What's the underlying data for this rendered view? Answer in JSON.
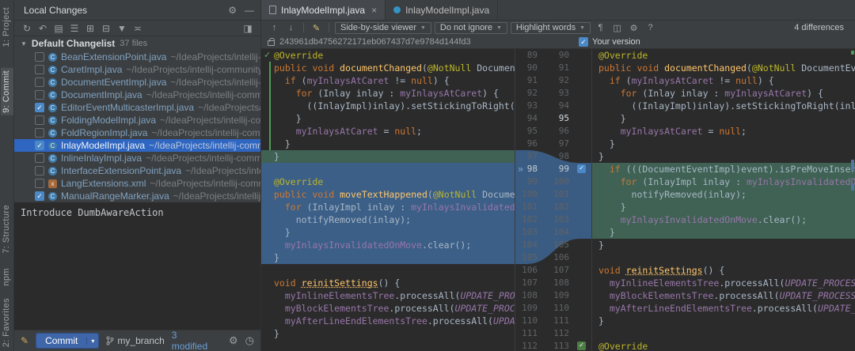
{
  "colors": {
    "accent": "#3592c4",
    "selection": "#2f66c1",
    "diff_changed": "#3c5f87",
    "diff_inserted": "#3f6254",
    "included_green": "#4e9c55"
  },
  "activity_bar": {
    "items": [
      {
        "id": "project",
        "label": "1: Project",
        "active": false
      },
      {
        "id": "commit",
        "label": "9: Commit",
        "active": true
      },
      {
        "id": "structure",
        "label": "7: Structure",
        "active": false
      },
      {
        "id": "npm",
        "label": "npm",
        "active": false
      },
      {
        "id": "favorites",
        "label": "2: Favorites",
        "active": false
      }
    ]
  },
  "changes_panel": {
    "title": "Local Changes",
    "header_icons": [
      {
        "id": "view-options",
        "glyph": "⚙"
      },
      {
        "id": "hide-panel",
        "glyph": "—"
      }
    ],
    "toolbar_icons": [
      {
        "id": "refresh",
        "glyph": "↻"
      },
      {
        "id": "rollback",
        "glyph": "↶"
      },
      {
        "id": "changelist",
        "glyph": "▤"
      },
      {
        "id": "group-by",
        "glyph": "☰"
      },
      {
        "id": "expand-all",
        "glyph": "⊞"
      },
      {
        "id": "collapse-all",
        "glyph": "⊟"
      },
      {
        "id": "filter",
        "glyph": "▼"
      },
      {
        "id": "compare",
        "glyph": "≍"
      }
    ],
    "toolbar_right_icon": {
      "id": "preview-diff",
      "glyph": "◨"
    },
    "changelist": {
      "expander": "▼",
      "name": "Default Changelist",
      "count": "37 files"
    },
    "files": [
      {
        "name": "BeanExtensionPoint.java",
        "path": "~/IdeaProjects/intellij-community",
        "checked": false,
        "selected": false,
        "type": "java"
      },
      {
        "name": "CaretImpl.java",
        "path": "~/IdeaProjects/intellij-community/p",
        "checked": false,
        "selected": false,
        "type": "java"
      },
      {
        "name": "DocumentEventImpl.java",
        "path": "~/IdeaProjects/intellij-community",
        "checked": false,
        "selected": false,
        "type": "java"
      },
      {
        "name": "DocumentImpl.java",
        "path": "~/IdeaProjects/intellij-community",
        "checked": false,
        "selected": false,
        "type": "java"
      },
      {
        "name": "EditorEventMulticasterImpl.java",
        "path": "~/IdeaProjects/intellij-community",
        "checked": true,
        "selected": false,
        "type": "java"
      },
      {
        "name": "FoldingModelImpl.java",
        "path": "~/IdeaProjects/intellij-community",
        "checked": false,
        "selected": false,
        "type": "java"
      },
      {
        "name": "FoldRegionImpl.java",
        "path": "~/IdeaProjects/intellij-community",
        "checked": false,
        "selected": false,
        "type": "java"
      },
      {
        "name": "InlayModelImpl.java",
        "path": "~/IdeaProjects/intellij-community",
        "checked": true,
        "selected": true,
        "type": "java"
      },
      {
        "name": "InlineInlayImpl.java",
        "path": "~/IdeaProjects/intellij-community",
        "checked": false,
        "selected": false,
        "type": "java"
      },
      {
        "name": "InterfaceExtensionPoint.java",
        "path": "~/IdeaProjects/intellij-community",
        "checked": false,
        "selected": false,
        "type": "java"
      },
      {
        "name": "LangExtensions.xml",
        "path": "~/IdeaProjects/intellij-community",
        "checked": false,
        "selected": false,
        "type": "xml"
      },
      {
        "name": "ManualRangeMarker.java",
        "path": "~/IdeaProjects/intellij-community",
        "checked": true,
        "selected": false,
        "type": "java"
      }
    ],
    "commit_message": "Introduce DumbAwareAction",
    "footer": {
      "commit_label": "Commit",
      "commit_arrow": "▾",
      "branch": "my_branch",
      "modified": "3 modified"
    }
  },
  "diff": {
    "tabs": [
      {
        "label": "InlayModelImpl.java",
        "close": "×"
      },
      {
        "label": "InlayModelImpl.java"
      }
    ],
    "toolbar": {
      "prev": "↑",
      "next": "↓",
      "edit": "✎",
      "viewer": "Side-by-side viewer",
      "ignore": "Do not ignore",
      "highlight": "Highlight words",
      "whitespace_glyph": "¶",
      "collapse_glyph": "◫",
      "settings_glyph": "⚙",
      "help": "?",
      "differences": "4 differences"
    },
    "left_title": "243961db4756272171eb067437d7e9784d144fd3",
    "right_title": "Your version",
    "current_change_row": 10,
    "bottom_check_row": 24,
    "apply_glyph": "»",
    "left_lines": [
      {
        "ln": 89,
        "seg": [
          [
            "a",
            "@Override"
          ]
        ]
      },
      {
        "ln": 90,
        "seg": [
          [
            "k",
            "public"
          ],
          [
            "t",
            " "
          ],
          [
            "k",
            "void"
          ],
          [
            "t",
            " "
          ],
          [
            "m",
            "documentChanged"
          ],
          [
            "t",
            "("
          ],
          [
            "a",
            "@NotNull"
          ],
          [
            "t",
            " DocumentEvent"
          ]
        ]
      },
      {
        "ln": 91,
        "seg": [
          [
            "t",
            "  "
          ],
          [
            "k",
            "if"
          ],
          [
            "t",
            " ("
          ],
          [
            "f",
            "myInlaysAtCaret"
          ],
          [
            "t",
            " != "
          ],
          [
            "k",
            "null"
          ],
          [
            "t",
            ") {"
          ]
        ]
      },
      {
        "ln": 92,
        "seg": [
          [
            "t",
            "    "
          ],
          [
            "k",
            "for"
          ],
          [
            "t",
            " (Inlay inlay : "
          ],
          [
            "f",
            "myInlaysAtCaret"
          ],
          [
            "t",
            ") {"
          ]
        ]
      },
      {
        "ln": 93,
        "seg": [
          [
            "t",
            "      ((InlayImpl)inlay).setStickingToRight(int"
          ]
        ]
      },
      {
        "ln": 94,
        "seg": [
          [
            "t",
            "    }"
          ]
        ]
      },
      {
        "ln": 95,
        "seg": [
          [
            "t",
            "    "
          ],
          [
            "f",
            "myInlaysAtCaret"
          ],
          [
            "t",
            " = "
          ],
          [
            "k",
            "null"
          ],
          [
            "t",
            ";"
          ]
        ]
      },
      {
        "ln": 96,
        "seg": [
          [
            "t",
            "  }"
          ]
        ]
      },
      {
        "ln": 97,
        "bg": "g",
        "seg": [
          [
            "t",
            "}"
          ]
        ]
      },
      {
        "ln": 98,
        "bg": "b",
        "seg": []
      },
      {
        "ln": 99,
        "bg": "b",
        "seg": [
          [
            "a",
            "@Override"
          ]
        ]
      },
      {
        "ln": 100,
        "bg": "b",
        "seg": [
          [
            "k",
            "public"
          ],
          [
            "t",
            " "
          ],
          [
            "k",
            "void"
          ],
          [
            "t",
            " "
          ],
          [
            "m",
            "moveTextHappened"
          ],
          [
            "t",
            "("
          ],
          [
            "a",
            "@NotNull"
          ],
          [
            "t",
            " DocumentEvent"
          ]
        ]
      },
      {
        "ln": 101,
        "bg": "b",
        "seg": [
          [
            "t",
            "  "
          ],
          [
            "k",
            "for"
          ],
          [
            "t",
            " (InlayImpl inlay : "
          ],
          [
            "f",
            "myInlaysInvalidatedOnMove"
          ],
          [
            "t",
            ") {"
          ]
        ]
      },
      {
        "ln": 102,
        "bg": "b",
        "seg": [
          [
            "t",
            "    notifyRemoved(inlay);"
          ]
        ]
      },
      {
        "ln": 103,
        "bg": "b",
        "seg": [
          [
            "t",
            "  }"
          ]
        ]
      },
      {
        "ln": 104,
        "bg": "b",
        "seg": [
          [
            "t",
            "  "
          ],
          [
            "f",
            "myInlaysInvalidatedOnMove"
          ],
          [
            "t",
            ".clear();"
          ]
        ]
      },
      {
        "ln": 105,
        "bg": "b",
        "seg": [
          [
            "t",
            "}"
          ]
        ]
      },
      {
        "ln": 106,
        "seg": []
      },
      {
        "ln": 107,
        "seg": [
          [
            "k",
            "void"
          ],
          [
            "t",
            " "
          ],
          [
            "mu",
            "reinitSettings"
          ],
          [
            "t",
            "() {"
          ]
        ]
      },
      {
        "ln": 108,
        "seg": [
          [
            "t",
            "  "
          ],
          [
            "f",
            "myInlineElementsTree"
          ],
          [
            "t",
            ".processAll("
          ],
          [
            "c",
            "UPDATE_PROCESSOR"
          ]
        ]
      },
      {
        "ln": 109,
        "seg": [
          [
            "t",
            "  "
          ],
          [
            "f",
            "myBlockElementsTree"
          ],
          [
            "t",
            ".processAll("
          ],
          [
            "c",
            "UPDATE_PROCESSOR"
          ]
        ]
      },
      {
        "ln": 110,
        "seg": [
          [
            "t",
            "  "
          ],
          [
            "f",
            "myAfterLineEndElementsTree"
          ],
          [
            "t",
            ".processAll("
          ],
          [
            "c",
            "UPDATE_PR"
          ]
        ]
      },
      {
        "ln": 111,
        "seg": [
          [
            "t",
            "}"
          ]
        ]
      },
      {
        "ln": 112,
        "seg": []
      }
    ],
    "right_lines": [
      {
        "ln": 90,
        "seg": [
          [
            "a",
            "@Override"
          ]
        ]
      },
      {
        "ln": 91,
        "seg": [
          [
            "k",
            "public"
          ],
          [
            "t",
            " "
          ],
          [
            "k",
            "void"
          ],
          [
            "t",
            " "
          ],
          [
            "m",
            "documentChanged"
          ],
          [
            "t",
            "("
          ],
          [
            "a",
            "@NotNull"
          ],
          [
            "t",
            " DocumentEvent e"
          ]
        ]
      },
      {
        "ln": 92,
        "seg": [
          [
            "t",
            "  "
          ],
          [
            "k",
            "if"
          ],
          [
            "t",
            " ("
          ],
          [
            "f",
            "myInlaysAtCaret"
          ],
          [
            "t",
            " != "
          ],
          [
            "k",
            "null"
          ],
          [
            "t",
            ") {"
          ]
        ]
      },
      {
        "ln": 93,
        "seg": [
          [
            "t",
            "    "
          ],
          [
            "k",
            "for"
          ],
          [
            "t",
            " (Inlay inlay : "
          ],
          [
            "f",
            "myInlaysAtCaret"
          ],
          [
            "t",
            ") {"
          ]
        ]
      },
      {
        "ln": 94,
        "seg": [
          [
            "t",
            "      ((InlayImpl)inlay).setStickingToRight(inlay."
          ]
        ]
      },
      {
        "ln": 95,
        "hl": true,
        "seg": [
          [
            "t",
            "    }"
          ]
        ]
      },
      {
        "ln": 96,
        "seg": [
          [
            "t",
            "    "
          ],
          [
            "f",
            "myInlaysAtCaret"
          ],
          [
            "t",
            " = "
          ],
          [
            "k",
            "null"
          ],
          [
            "t",
            ";"
          ]
        ]
      },
      {
        "ln": 97,
        "seg": [
          [
            "t",
            "  }"
          ]
        ]
      },
      {
        "ln": 98,
        "seg": [
          [
            "t",
            "}"
          ]
        ]
      },
      {
        "ln": 99,
        "bg": "g",
        "seg": [
          [
            "t",
            "  "
          ],
          [
            "k",
            "if"
          ],
          [
            "t",
            " (((DocumentEventImpl)event).isPreMoveInsertion"
          ]
        ]
      },
      {
        "ln": 100,
        "bg": "g",
        "seg": [
          [
            "t",
            "    "
          ],
          [
            "k",
            "for"
          ],
          [
            "t",
            " (InlayImpl inlay : "
          ],
          [
            "f",
            "myInlaysInvalidatedOnMove"
          ],
          [
            "t",
            ") {"
          ]
        ]
      },
      {
        "ln": 101,
        "bg": "g",
        "seg": [
          [
            "t",
            "      notifyRemoved(inlay);"
          ]
        ]
      },
      {
        "ln": 102,
        "bg": "g",
        "seg": [
          [
            "t",
            "    }"
          ]
        ]
      },
      {
        "ln": 103,
        "bg": "g",
        "seg": [
          [
            "t",
            "    "
          ],
          [
            "f",
            "myInlaysInvalidatedOnMove"
          ],
          [
            "t",
            ".clear();"
          ]
        ]
      },
      {
        "ln": 104,
        "bg": "g",
        "seg": [
          [
            "t",
            "  }"
          ]
        ]
      },
      {
        "ln": 105,
        "seg": [
          [
            "t",
            "}"
          ]
        ]
      },
      {
        "ln": 106,
        "seg": []
      },
      {
        "ln": 107,
        "seg": [
          [
            "k",
            "void"
          ],
          [
            "t",
            " "
          ],
          [
            "mu",
            "reinitSettings"
          ],
          [
            "t",
            "() {"
          ]
        ]
      },
      {
        "ln": 108,
        "seg": [
          [
            "t",
            "  "
          ],
          [
            "f",
            "myInlineElementsTree"
          ],
          [
            "t",
            ".processAll("
          ],
          [
            "c",
            "UPDATE_PROCESSOR"
          ],
          [
            "t",
            ")"
          ]
        ]
      },
      {
        "ln": 109,
        "seg": [
          [
            "t",
            "  "
          ],
          [
            "f",
            "myBlockElementsTree"
          ],
          [
            "t",
            ".processAll("
          ],
          [
            "c",
            "UPDATE_PROCESSOR"
          ],
          [
            "t",
            ")"
          ]
        ]
      },
      {
        "ln": 110,
        "seg": [
          [
            "t",
            "  "
          ],
          [
            "f",
            "myAfterLineEndElementsTree"
          ],
          [
            "t",
            ".processAll("
          ],
          [
            "c",
            "UPDATE_PROCESSOR"
          ]
        ]
      },
      {
        "ln": 111,
        "seg": [
          [
            "t",
            "}"
          ]
        ]
      },
      {
        "ln": 112,
        "seg": []
      },
      {
        "ln": 113,
        "seg": [
          [
            "a",
            "@Override"
          ]
        ]
      }
    ]
  }
}
